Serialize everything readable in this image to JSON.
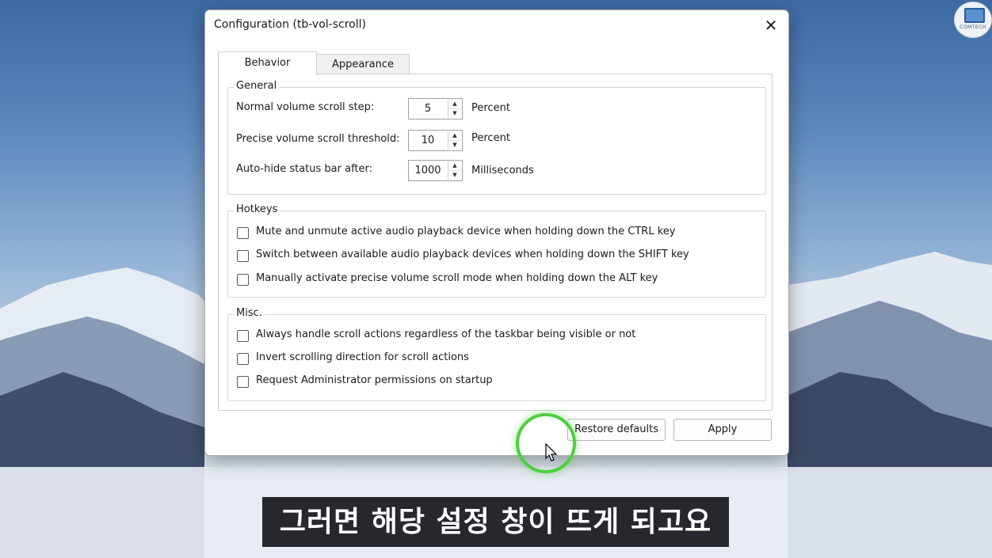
{
  "window": {
    "title": "Configuration (tb-vol-scroll)",
    "close_glyph": "✕"
  },
  "tabs": [
    {
      "label": "Behavior",
      "selected": true
    },
    {
      "label": "Appearance",
      "selected": false
    }
  ],
  "general": {
    "group_label": "General",
    "rows": [
      {
        "label": "Normal volume scroll step:",
        "value": "5",
        "unit": "Percent"
      },
      {
        "label": "Precise volume scroll threshold:",
        "value": "10",
        "unit": "Percent"
      },
      {
        "label": "Auto-hide status bar after:",
        "value": "1000",
        "unit": "Milliseconds"
      }
    ]
  },
  "hotkeys": {
    "group_label": "Hotkeys",
    "options": [
      {
        "label": "Mute and unmute active audio playback device when holding down the CTRL key",
        "checked": false
      },
      {
        "label": "Switch between available audio playback devices when holding down the SHIFT key",
        "checked": false
      },
      {
        "label": "Manually activate precise volume scroll mode when holding down the ALT key",
        "checked": false
      }
    ]
  },
  "misc": {
    "group_label": "Misc.",
    "options": [
      {
        "label": "Always handle scroll actions regardless of the taskbar being visible or not",
        "checked": false
      },
      {
        "label": "Invert scrolling direction for scroll actions",
        "checked": false
      },
      {
        "label": "Request Administrator permissions on startup",
        "checked": false
      }
    ]
  },
  "buttons": {
    "restore_defaults": "Restore defaults",
    "apply": "Apply"
  },
  "overlay": {
    "subtitle": "그러면 해당 설정 창이 뜨게 되고요",
    "channel_logo_text": "COMTECH",
    "highlight_color": "#4ccf3c"
  },
  "icons": {
    "spin_up": "▲",
    "spin_down": "▼"
  }
}
